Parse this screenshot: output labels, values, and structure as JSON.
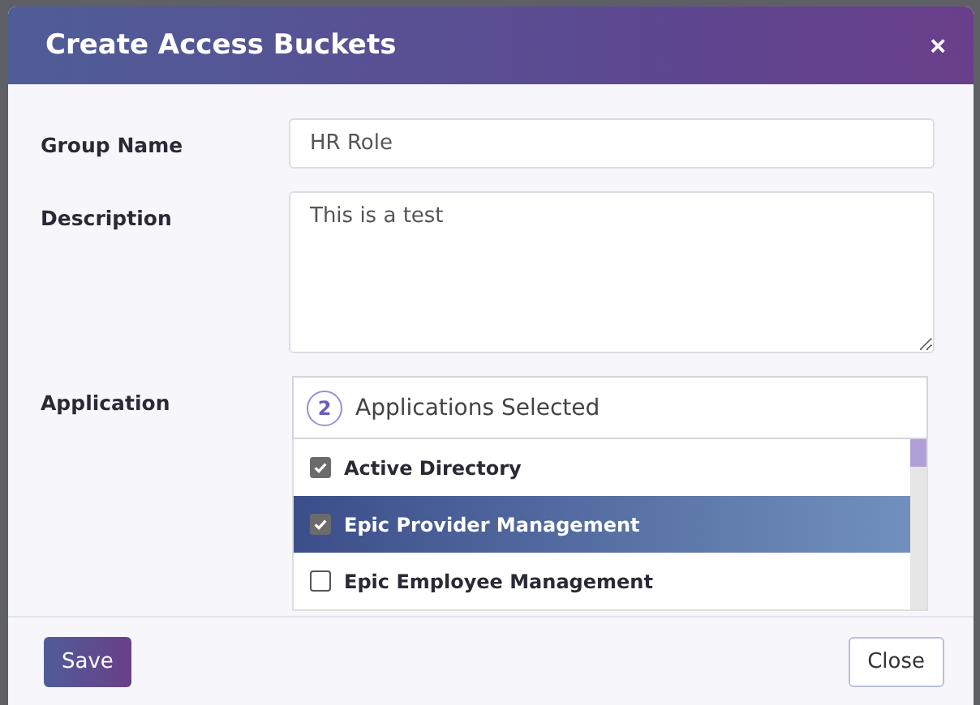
{
  "dialog": {
    "title": "Create Access Buckets",
    "close_symbol": "×"
  },
  "fields": [
    {
      "kind": "input",
      "label": "Group Name",
      "value": "HR Role"
    },
    {
      "kind": "textarea",
      "label": "Description",
      "value": "This is a test"
    },
    {
      "kind": "multiselect",
      "label": "Application",
      "count": "2",
      "summary": "Applications Selected",
      "options": [
        {
          "label": "Active Directory",
          "checked": true,
          "selected": false
        },
        {
          "label": "Epic Provider Management",
          "checked": true,
          "selected": true
        },
        {
          "label": "Epic Employee Management",
          "checked": false,
          "selected": false
        }
      ]
    }
  ],
  "buttons": [
    {
      "kind": "primary",
      "label": "Save"
    },
    {
      "kind": "secondary",
      "label": "Close"
    }
  ]
}
